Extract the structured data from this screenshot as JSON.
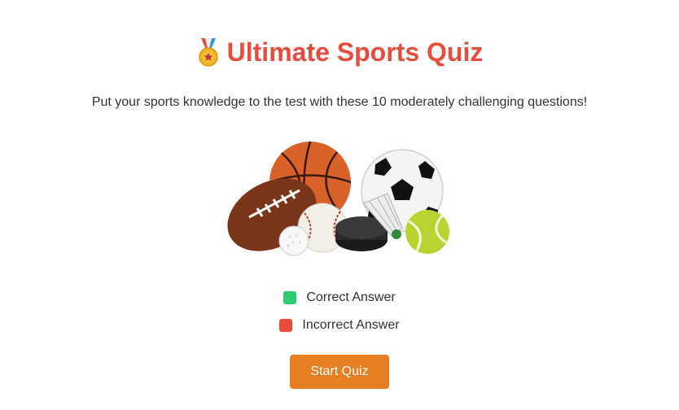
{
  "header": {
    "icon": "medal-icon",
    "title": "Ultimate Sports Quiz"
  },
  "intro": {
    "text": "Put your sports knowledge to the test with these 10 moderately challenging questions!"
  },
  "hero_image": {
    "description": "sports balls illustration"
  },
  "legend": {
    "correct_label": "Correct Answer",
    "correct_color": "#2ecc71",
    "incorrect_label": "Incorrect Answer",
    "incorrect_color": "#e74c3c"
  },
  "actions": {
    "start_label": "Start Quiz",
    "start_color": "#e67e22"
  }
}
